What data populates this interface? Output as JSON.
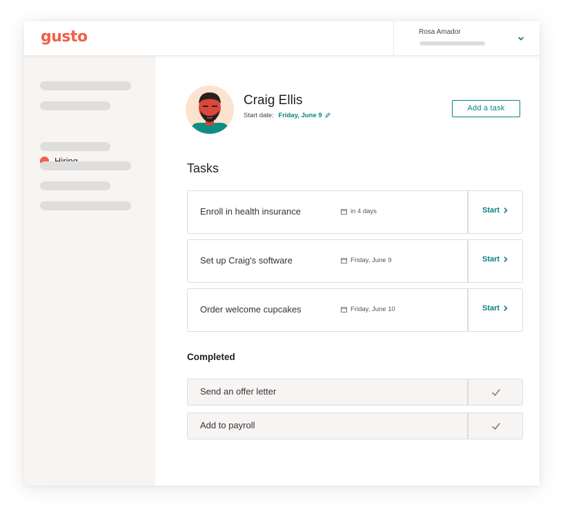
{
  "brand": {
    "logo_text": "gusto",
    "accent_color": "#f45d48",
    "link_color": "#0a8080"
  },
  "header": {
    "user_name": "Rosa Amador",
    "menu_icon": "chevron-down-icon"
  },
  "sidebar": {
    "active_item": {
      "label": "Hiring",
      "dot_color": "#f45d48"
    }
  },
  "profile": {
    "name": "Craig Ellis",
    "start_label": "Start date:",
    "start_date": "Friday, June 9",
    "edit_icon": "pencil-icon"
  },
  "actions": {
    "add_task_label": "Add a task"
  },
  "tasks": {
    "heading": "Tasks",
    "items": [
      {
        "title": "Enroll in health insurance",
        "due": "in 4 days",
        "action": "Start"
      },
      {
        "title": "Set up Craig's software",
        "due": "Friday, June 9",
        "action": "Start"
      },
      {
        "title": "Order welcome cupcakes",
        "due": "Friday, June 10",
        "action": "Start"
      }
    ]
  },
  "completed": {
    "heading": "Completed",
    "items": [
      {
        "title": "Send an offer letter",
        "status_icon": "check-icon"
      },
      {
        "title": "Add to payroll",
        "status_icon": "check-icon"
      }
    ]
  }
}
